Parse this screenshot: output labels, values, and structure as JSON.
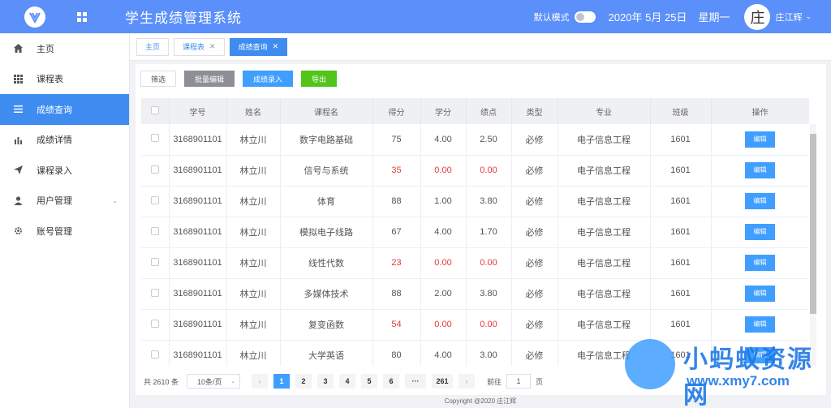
{
  "header": {
    "title": "学生成绩管理系统",
    "mode_label": "默认模式",
    "date": "2020年 5月 25日",
    "weekday": "星期一",
    "avatar_char": "庄",
    "username": "庄江辉",
    "accent": "#5b8ff9"
  },
  "sidebar": {
    "items": [
      {
        "label": "主页",
        "icon": "home-icon"
      },
      {
        "label": "课程表",
        "icon": "grid-icon"
      },
      {
        "label": "成绩查询",
        "icon": "list-icon",
        "active": true
      },
      {
        "label": "成绩详情",
        "icon": "bar-chart-icon"
      },
      {
        "label": "课程录入",
        "icon": "send-icon"
      },
      {
        "label": "用户管理",
        "icon": "user-icon",
        "expandable": true
      },
      {
        "label": "账号管理",
        "icon": "gear-icon"
      }
    ]
  },
  "tabs": [
    {
      "label": "主页"
    },
    {
      "label": "课程表"
    },
    {
      "label": "成绩查询",
      "active": true
    }
  ],
  "toolbar": {
    "filter": "筛选",
    "batch_edit": "批量编辑",
    "enter_scores": "成绩录入",
    "export": "导出"
  },
  "table": {
    "headers": [
      "学号",
      "姓名",
      "课程名",
      "得分",
      "学分",
      "绩点",
      "类型",
      "专业",
      "班级",
      "操作"
    ],
    "edit_label": "编辑",
    "rows": [
      [
        "3168901101",
        "林立川",
        "数字电路基础",
        "75",
        "4.00",
        "2.50",
        "必修",
        "电子信息工程",
        "1601"
      ],
      [
        "3168901101",
        "林立川",
        "信号与系统",
        "35",
        "0.00",
        "0.00",
        "必修",
        "电子信息工程",
        "1601"
      ],
      [
        "3168901101",
        "林立川",
        "体育",
        "88",
        "1.00",
        "3.80",
        "必修",
        "电子信息工程",
        "1601"
      ],
      [
        "3168901101",
        "林立川",
        "模拟电子线路",
        "67",
        "4.00",
        "1.70",
        "必修",
        "电子信息工程",
        "1601"
      ],
      [
        "3168901101",
        "林立川",
        "线性代数",
        "23",
        "0.00",
        "0.00",
        "必修",
        "电子信息工程",
        "1601"
      ],
      [
        "3168901101",
        "林立川",
        "多媒体技术",
        "88",
        "2.00",
        "3.80",
        "必修",
        "电子信息工程",
        "1601"
      ],
      [
        "3168901101",
        "林立川",
        "复变函数",
        "54",
        "0.00",
        "0.00",
        "必修",
        "电子信息工程",
        "1601"
      ],
      [
        "3168901101",
        "林立川",
        "大学英语",
        "80",
        "4.00",
        "3.00",
        "必修",
        "电子信息工程",
        "1601"
      ]
    ],
    "failing_color": "#e53935"
  },
  "pagination": {
    "total": "共 2610 条",
    "page_size": "10条/页",
    "prev": "‹",
    "next": "›",
    "pages": [
      "1",
      "2",
      "3",
      "4",
      "5",
      "6",
      "···",
      "261"
    ],
    "current": "1",
    "goto_label": "前往",
    "goto_value": "1",
    "goto_unit": "页"
  },
  "footer": "Copyright @2020 庄江辉",
  "watermark": {
    "text": "小蚂蚁资源网",
    "url": "www.xmy7.com"
  }
}
